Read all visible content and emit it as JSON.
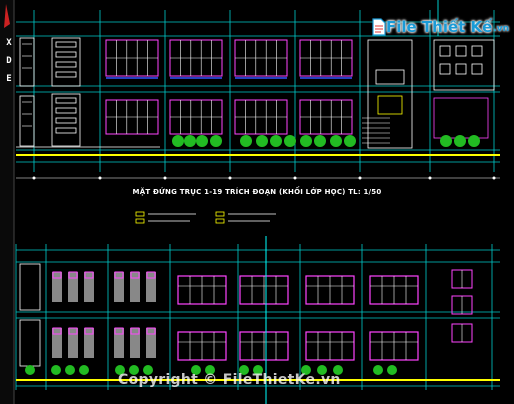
{
  "drawing": {
    "caption": "MẶT ĐỨNG TRỤC 1-19 TRÍCH ĐOẠN (KHỐI LỚP HỌC) TL: 1/50"
  },
  "toolbar": {
    "close_glyph": "X",
    "d_glyph": "D",
    "e_glyph": "E"
  },
  "logo": {
    "main": "File Thiết Kế",
    "suffix": ".vn"
  },
  "watermark": {
    "text": "Copyright © FileThietKe.vn"
  },
  "colors": {
    "background": "#000000",
    "cyan": "#00ffff",
    "magenta": "#ff00ff",
    "yellow": "#ffff00",
    "green": "#22bb22",
    "white": "#ffffff",
    "blue": "#3355ff",
    "red": "#ff3333"
  }
}
